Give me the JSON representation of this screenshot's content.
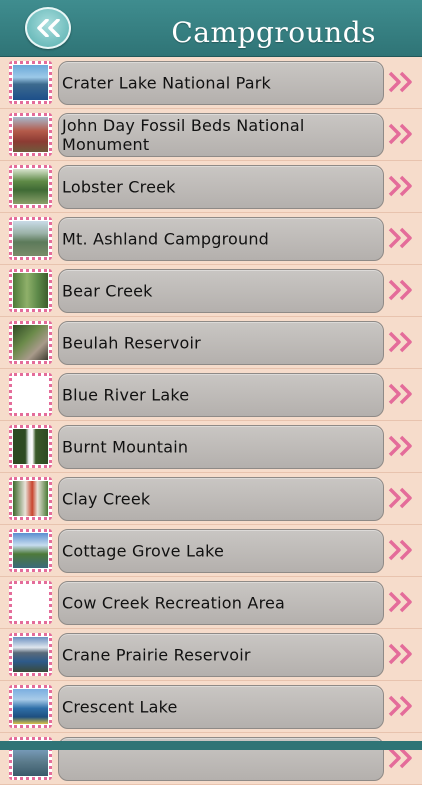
{
  "header": {
    "title": "Campgrounds",
    "back_icon": "double-chevron-left-icon",
    "color": "#3a8587"
  },
  "list": {
    "item_icon": "double-chevron-right-icon",
    "accent_color": "#e46c9a",
    "items": [
      {
        "label": "Crater Lake National Park"
      },
      {
        "label": "John Day Fossil Beds National Monument"
      },
      {
        "label": "Lobster Creek"
      },
      {
        "label": "Mt. Ashland Campground"
      },
      {
        "label": "Bear Creek"
      },
      {
        "label": "Beulah Reservoir"
      },
      {
        "label": "Blue River Lake"
      },
      {
        "label": "Burnt Mountain"
      },
      {
        "label": "Clay Creek"
      },
      {
        "label": "Cottage Grove Lake"
      },
      {
        "label": "Cow Creek Recreation Area"
      },
      {
        "label": "Crane Prairie Reservoir"
      },
      {
        "label": "Crescent Lake"
      },
      {
        "label": ""
      }
    ]
  }
}
